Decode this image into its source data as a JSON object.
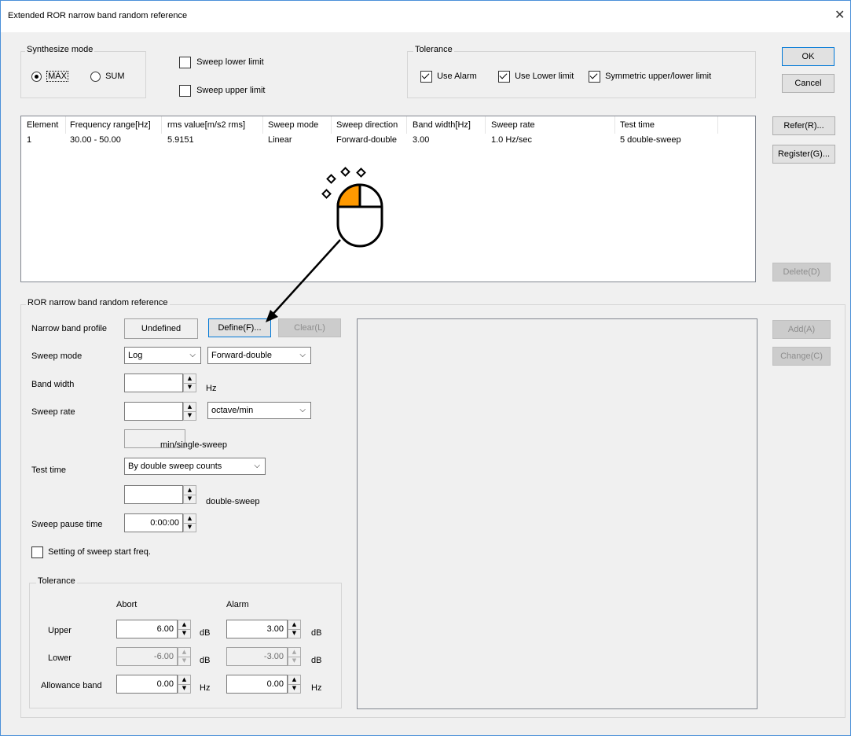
{
  "window": {
    "title": "Extended ROR narrow band random reference",
    "close_glyph": "✕"
  },
  "synth": {
    "legend": "Synthesize mode",
    "max": "MAX",
    "sum": "SUM",
    "selected": "MAX"
  },
  "sweep_limits": {
    "lower": "Sweep lower limit",
    "upper": "Sweep upper limit",
    "lower_checked": false,
    "upper_checked": false
  },
  "tolerance_top": {
    "legend": "Tolerance",
    "use_alarm": "Use Alarm",
    "use_lower": "Use Lower limit",
    "symmetric": "Symmetric upper/lower limit"
  },
  "right_buttons": {
    "ok": "OK",
    "cancel": "Cancel",
    "refer": "Refer(R)...",
    "register": "Register(G)...",
    "delete": "Delete(D)",
    "add": "Add(A)",
    "change": "Change(C)"
  },
  "table": {
    "columns": [
      "Element",
      "Frequency range[Hz]",
      "rms value[m/s2 rms]",
      "Sweep mode",
      "Sweep direction",
      "Band width[Hz]",
      "Sweep rate",
      "Test time"
    ],
    "rows": [
      [
        "1",
        "30.00 - 50.00",
        "5.9151",
        "Linear",
        "Forward-double",
        "3.00",
        "1.0 Hz/sec",
        "5 double-sweep"
      ]
    ]
  },
  "ror": {
    "legend": "ROR narrow band random reference",
    "narrow_profile_label": "Narrow band profile",
    "narrow_profile_value": "Undefined",
    "define_button": "Define(F)...",
    "clear_button": "Clear(L)",
    "sweep_mode_label": "Sweep mode",
    "sweep_mode_value": "Log",
    "sweep_direction_value": "Forward-double",
    "band_width_label": "Band width",
    "band_width_unit": "Hz",
    "sweep_rate_label": "Sweep rate",
    "sweep_rate_unit_value": "octave/min",
    "single_sweep_unit": "min/single-sweep",
    "test_time_label": "Test time",
    "test_time_value": "By double sweep counts",
    "double_sweep_unit": "double-sweep",
    "pause_label": "Sweep pause time",
    "pause_value": "0:00:00",
    "start_freq_label": "Setting of sweep start freq."
  },
  "tol": {
    "legend": "Tolerance",
    "abort": "Abort",
    "alarm": "Alarm",
    "upper_label": "Upper",
    "lower_label": "Lower",
    "allowance_label": "Allowance band",
    "upper_abort": "6.00",
    "upper_alarm": "3.00",
    "lower_abort": "-6.00",
    "lower_alarm": "-3.00",
    "allow_abort": "0.00",
    "allow_alarm": "0.00",
    "db": "dB",
    "hz": "Hz"
  },
  "icons": {
    "cursor": "mouse-click-icon",
    "arrow": "pointer-arrow-icon"
  },
  "colors": {
    "accent": "#ff9900",
    "border_focus": "#0078d7"
  }
}
